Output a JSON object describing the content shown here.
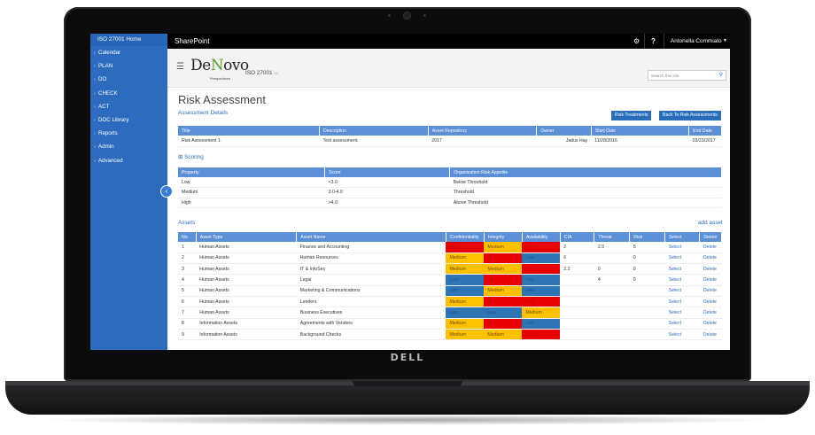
{
  "device": {
    "brand": "DELL"
  },
  "topbar": {
    "app_title": "SharePoint",
    "user": "Antonella Commiato"
  },
  "leftnav": {
    "home": "ISO 27001 Home",
    "items": [
      "Calendar",
      "PLAN",
      "DO",
      "CHECK",
      "ACT",
      "DOC Library",
      "Reports",
      "Admin",
      "Advanced"
    ]
  },
  "site": {
    "logo_main": "De",
    "logo_v": "N",
    "logo_end": "ovo",
    "logo_sub": "Perspectives",
    "title": "ISO 27001 ⌵",
    "search_placeholder": "Search this site"
  },
  "page": {
    "title": "Risk Assessment",
    "subtitle": "Assessment Details",
    "btn_treatments": "Risk Treatments",
    "btn_back": "Back To Risk Assessments",
    "scoring": "⊞ Scoring",
    "assets": "Assets",
    "add_asset": "add asset"
  },
  "details": {
    "headers": [
      "Title",
      "Description",
      "Asset Repository",
      "Owner",
      "Start Date",
      "End Date"
    ],
    "row": [
      "Risk Assessment 1",
      "Test assessment.",
      "2017",
      "Jadus Hay",
      "11/28/2016",
      "03/23/2017"
    ]
  },
  "scoring_table": {
    "headers": [
      "Property",
      "Score",
      "Organization Risk Appetite"
    ],
    "rows": [
      [
        "Low",
        "<3.0",
        "Below Threshold"
      ],
      [
        "Medium",
        "3.0-4.0",
        "Threshold"
      ],
      [
        "High",
        ">4.0",
        "Above Threshold"
      ]
    ]
  },
  "assets_table": {
    "headers": [
      "No.",
      "Asset Type",
      "Asset Name",
      "Confidentiality",
      "Integrity",
      "Availability",
      "CIA",
      "Threat",
      "Risk",
      "Select",
      "Delete"
    ],
    "rows": [
      {
        "no": "1",
        "type": "Human Assets",
        "name": "Finance and Accounting",
        "conf": [
          "High",
          "red"
        ],
        "int": [
          "Medium",
          "yellow"
        ],
        "avail": [
          "High",
          "red"
        ],
        "cia": "2",
        "threat": "2.5",
        "risk": "5"
      },
      {
        "no": "2",
        "type": "Human Assets",
        "name": "Human Resources",
        "conf": [
          "Medium",
          "yellow"
        ],
        "int": [
          "High",
          "red"
        ],
        "avail": [
          "Low",
          "blue"
        ],
        "cia": "6",
        "threat": "",
        "risk": "0"
      },
      {
        "no": "3",
        "type": "Human Assets",
        "name": "IT & InfoSec",
        "conf": [
          "Medium",
          "yellow"
        ],
        "int": [
          "Medium",
          "yellow"
        ],
        "avail": [
          "High",
          "red"
        ],
        "cia": "2.2",
        "threat": "0",
        "risk": "0"
      },
      {
        "no": "4",
        "type": "Human Assets",
        "name": "Legal",
        "conf": [
          "Low",
          "blue"
        ],
        "int": [
          "High",
          "red"
        ],
        "avail": [
          "Low",
          "blue"
        ],
        "cia": "",
        "threat": "4",
        "risk": "0"
      },
      {
        "no": "5",
        "type": "Human Assets",
        "name": "Marketing & Communications",
        "conf": [
          "Low",
          "blue"
        ],
        "int": [
          "Medium",
          "yellow"
        ],
        "avail": [
          "Low",
          "blue"
        ],
        "cia": "",
        "threat": "",
        "risk": ""
      },
      {
        "no": "6",
        "type": "Human Assets",
        "name": "Lenders",
        "conf": [
          "Medium",
          "yellow"
        ],
        "int": [
          "High",
          "red"
        ],
        "avail": [
          "High",
          "red"
        ],
        "cia": "",
        "threat": "",
        "risk": ""
      },
      {
        "no": "7",
        "type": "Human Assets",
        "name": "Business Executives",
        "conf": [
          "Low",
          "blue"
        ],
        "int": [
          "Low",
          "blue"
        ],
        "avail": [
          "Medium",
          "yellow"
        ],
        "cia": "",
        "threat": "",
        "risk": ""
      },
      {
        "no": "8",
        "type": "Information Assets",
        "name": "Agreements with Vendors",
        "conf": [
          "Medium",
          "yellow"
        ],
        "int": [
          "High",
          "red"
        ],
        "avail": [
          "Low",
          "blue"
        ],
        "cia": "",
        "threat": "",
        "risk": ""
      },
      {
        "no": "9",
        "type": "Information Assets",
        "name": "Background Checks",
        "conf": [
          "Medium",
          "yellow"
        ],
        "int": [
          "Medium",
          "yellow"
        ],
        "avail": [
          "High",
          "red"
        ],
        "cia": "",
        "threat": "",
        "risk": ""
      }
    ],
    "select_label": "Select",
    "delete_label": "Delete"
  },
  "colors": {
    "red": "#e60000",
    "yellow": "#ffc000",
    "blue": "#2e75b6",
    "header": "#5b8fd6",
    "nav": "#2d6bbf"
  }
}
